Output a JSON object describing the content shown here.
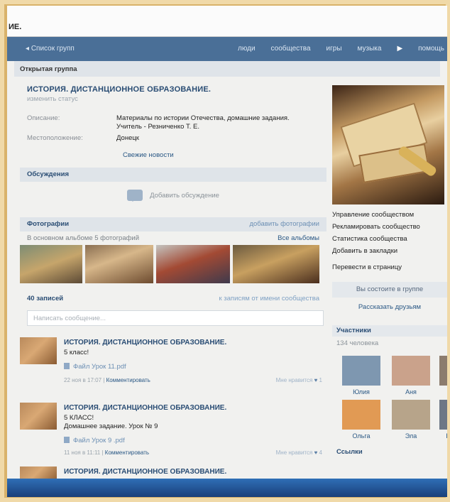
{
  "browser": {
    "title_fragment": "ИЕ."
  },
  "topnav": {
    "back_label": "Список групп",
    "items": [
      "люди",
      "сообщества",
      "игры",
      "музыка",
      "▶",
      "помощь"
    ]
  },
  "group": {
    "type_label": "Открытая группа",
    "title": "ИСТОРИЯ. ДИСТАНЦИОННОЕ ОБРАЗОВАНИЕ.",
    "status_placeholder": "изменить статус",
    "info": {
      "description_label": "Описание:",
      "description_value": "Материалы по истории Отечества, домашние задания. Учитель - Резниченко Т. Е.",
      "location_label": "Местоположение:",
      "location_value": "Донецк"
    },
    "fresh_news": "Свежие новости"
  },
  "discussions": {
    "header": "Обсуждения",
    "add_label": "Добавить обсуждение"
  },
  "photos": {
    "header": "Фотографии",
    "add_link": "добавить фотографии",
    "subtitle": "В основном альбоме 5 фотографий",
    "all_albums": "Все альбомы"
  },
  "wall": {
    "count": "40 записей",
    "filter_link": "к записям от имени сообщества",
    "compose_placeholder": "Написать сообщение...",
    "posts": [
      {
        "title": "ИСТОРИЯ. ДИСТАНЦИОННОЕ ОБРАЗОВАНИЕ.",
        "line1": "5 класс!",
        "line2": "",
        "file": "Файл Урок 11.pdf",
        "date": "22 ноя в 17:07",
        "comment": "Комментировать",
        "likes_label": "Мне нравится",
        "likes": "1"
      },
      {
        "title": "ИСТОРИЯ. ДИСТАНЦИОННОЕ ОБРАЗОВАНИЕ.",
        "line1": "5 КЛАСС!",
        "line2": "Домашнее задание. Урок № 9",
        "file": "Файл Урок 9 .pdf",
        "date": "11 ноя в 11:11",
        "comment": "Комментировать",
        "likes_label": "Мне нравится",
        "likes": "4"
      },
      {
        "title": "ИСТОРИЯ. ДИСТАНЦИОННОЕ ОБРАЗОВАНИЕ."
      }
    ]
  },
  "sidebar": {
    "actions": [
      "Управление сообществом",
      "Рекламировать сообщество",
      "Статистика сообщества",
      "Добавить в закладки",
      "Перевести в страницу"
    ],
    "member_button": "Вы состоите в группе",
    "tell_friends": "Рассказать друзьям",
    "members_header": "Участники",
    "members_count": "134 человека",
    "members": [
      {
        "name": "Юлия",
        "color": "#7e97b0"
      },
      {
        "name": "Аня",
        "color": "#caa28b"
      },
      {
        "name": "П",
        "color": "#8c7c6e"
      },
      {
        "name": "Ольга",
        "color": "#e19a54"
      },
      {
        "name": "Эла",
        "color": "#b7a48a"
      },
      {
        "name": "Ел",
        "color": "#6d7786"
      }
    ],
    "links_header": "Ссылки"
  },
  "colors": {
    "nav_bg": "#4a6f97",
    "link": "#2a5885",
    "header_bg": "#dfe4e9"
  }
}
